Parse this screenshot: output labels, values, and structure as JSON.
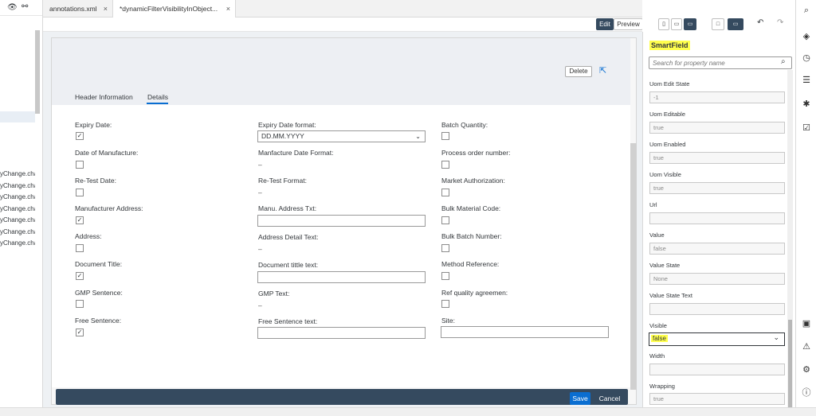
{
  "left_panel": {
    "files": [
      "yChange.cha",
      "yChange.cha",
      "yChange.cha",
      "yChange.cha",
      "yChange.cha",
      "yChange.cha",
      "yChange.cha"
    ]
  },
  "tabs": [
    {
      "label": "annotations.xml",
      "close": "×"
    },
    {
      "label": "*dynamicFilterVisibilityInObject...",
      "close": "×"
    }
  ],
  "toolbar": {
    "edit": "Edit",
    "preview": "Preview"
  },
  "object_page": {
    "delete_label": "Delete",
    "section_tabs": [
      "Header Information",
      "Details"
    ],
    "fields": {
      "expiry_date": "Expiry Date:",
      "expiry_date_format": "Expiry Date format:",
      "expiry_date_format_value": "DD.MM.YYYY",
      "batch_quantity": "Batch Quantity:",
      "date_of_manufacture": "Date of Manufacture:",
      "manufacture_date_format": "Manfacture Date Format:",
      "process_order_number": "Process order number:",
      "re_test_date": "Re-Test Date:",
      "re_test_format": "Re-Test Format:",
      "market_authorization": "Market Authorization:",
      "manufacturer_address": "Manufacturer Address:",
      "manu_address_txt": "Manu. Address Txt:",
      "bulk_material_code": "Bulk Material Code:",
      "address": "Address:",
      "address_detail_text": "Address Detail Text:",
      "bulk_batch_number": "Bulk Batch Number:",
      "document_title": "Document Title:",
      "document_title_text": "Document tittle text:",
      "method_reference": "Method Reference:",
      "gmp_sentence": "GMP Sentence:",
      "gmp_text": "GMP Text:",
      "ref_quality_agreement": "Ref quality agreemen:",
      "free_sentence": "Free Sentence:",
      "free_sentence_text": "Free Sentence text:",
      "site": "Site:"
    },
    "dash": "–",
    "footer": {
      "save": "Save",
      "cancel": "Cancel"
    }
  },
  "properties": {
    "control_name": "SmartField",
    "search_placeholder": "Search for property name",
    "items": [
      {
        "label": "Uom Edit State",
        "value": "-1"
      },
      {
        "label": "Uom Editable",
        "value": "true"
      },
      {
        "label": "Uom Enabled",
        "value": "true"
      },
      {
        "label": "Uom Visible",
        "value": "true"
      },
      {
        "label": "Url",
        "value": ""
      },
      {
        "label": "Value",
        "value": "false"
      },
      {
        "label": "Value State",
        "value": "None"
      },
      {
        "label": "Value State Text",
        "value": ""
      },
      {
        "label": "Visible",
        "value": "false"
      },
      {
        "label": "Width",
        "value": ""
      },
      {
        "label": "Wrapping",
        "value": "true"
      }
    ]
  },
  "colors": {
    "highlight": "#ffff4d",
    "shell": "#354a5f",
    "accent": "#0a6ed1"
  }
}
